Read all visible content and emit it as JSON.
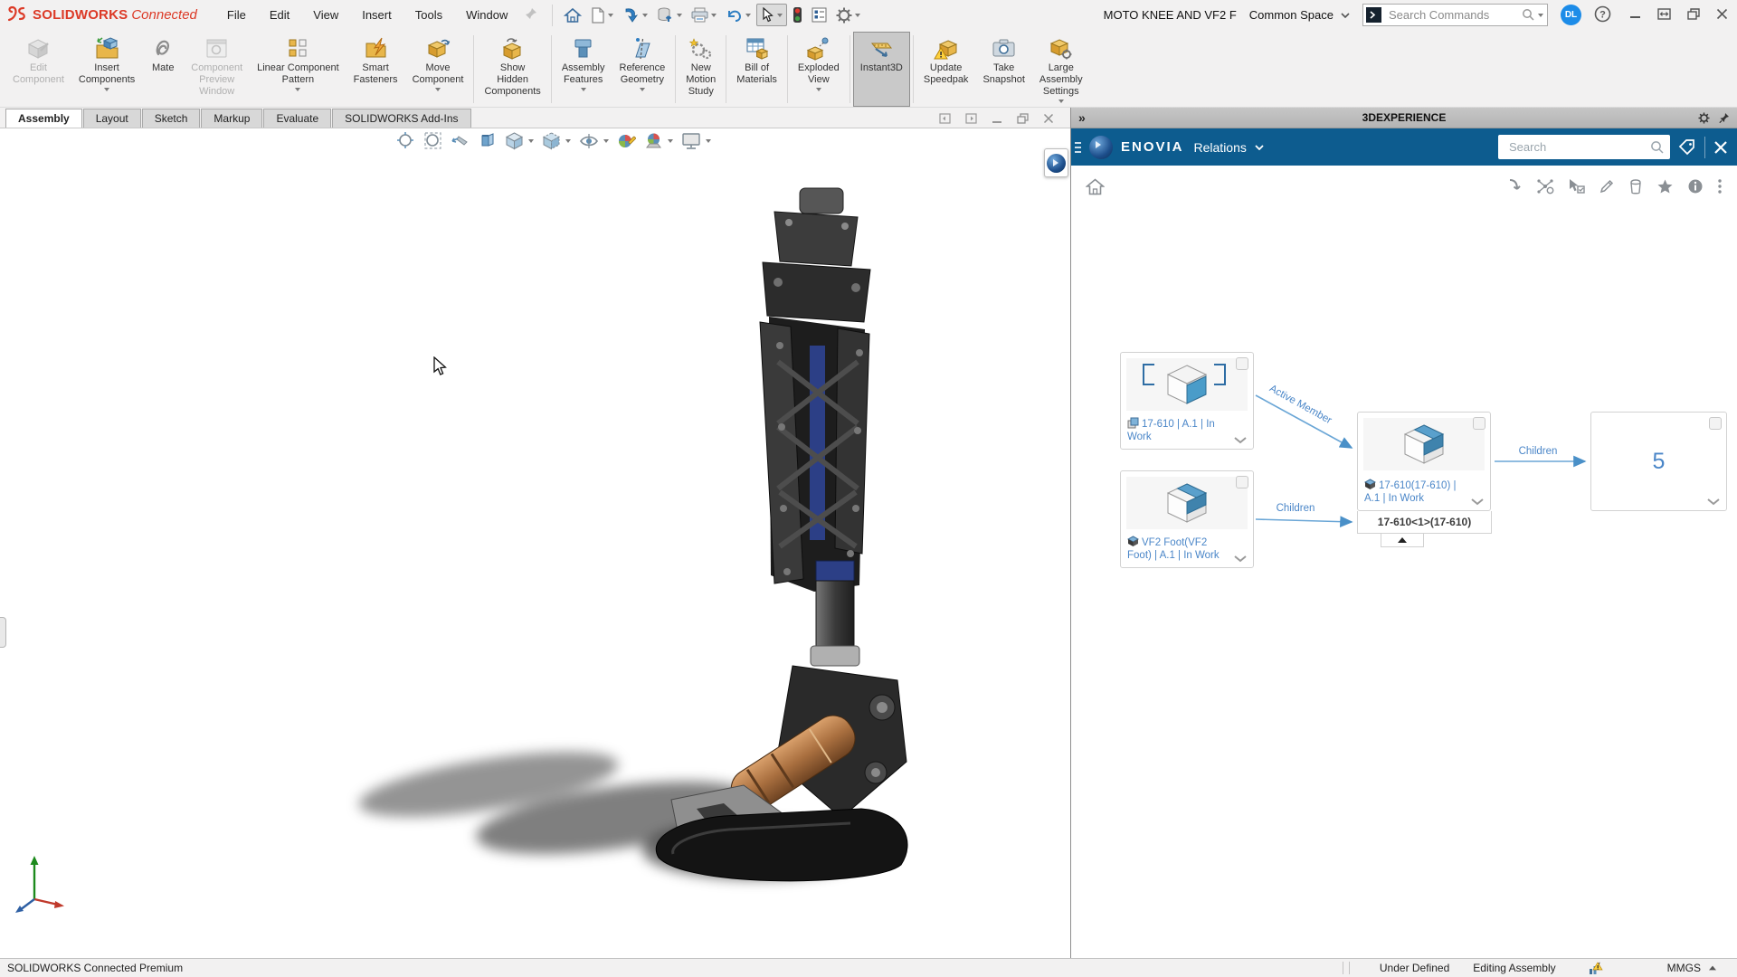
{
  "app": {
    "brand": "SOLIDWORKS",
    "brand_suffix": "Connected"
  },
  "menubar": {
    "menus": [
      "File",
      "Edit",
      "View",
      "Insert",
      "Tools",
      "Window"
    ],
    "doc_title": "MOTO KNEE AND VF2 F",
    "space": "Common Space",
    "search_placeholder": "Search Commands",
    "avatar_initials": "DL"
  },
  "ribbon": {
    "buttons": [
      {
        "label": "Edit\nComponent"
      },
      {
        "label": "Insert\nComponents"
      },
      {
        "label": "Mate"
      },
      {
        "label": "Component\nPreview\nWindow"
      },
      {
        "label": "Linear Component\nPattern"
      },
      {
        "label": "Smart\nFasteners"
      },
      {
        "label": "Move\nComponent"
      },
      {
        "label": "Show\nHidden\nComponents"
      },
      {
        "label": "Assembly\nFeatures"
      },
      {
        "label": "Reference\nGeometry"
      },
      {
        "label": "New\nMotion\nStudy"
      },
      {
        "label": "Bill of\nMaterials"
      },
      {
        "label": "Exploded\nView"
      },
      {
        "label": "Instant3D"
      },
      {
        "label": "Update\nSpeedpak"
      },
      {
        "label": "Take\nSnapshot"
      },
      {
        "label": "Large\nAssembly\nSettings"
      }
    ]
  },
  "tabbar": {
    "tabs": [
      "Assembly",
      "Layout",
      "Sketch",
      "Markup",
      "Evaluate",
      "SOLIDWORKS Add-Ins"
    ]
  },
  "panel": {
    "window_title": "3DEXPERIENCE",
    "app_name": "ENOVIA",
    "view_name": "Relations",
    "search_placeholder": "Search",
    "graph": {
      "nodes": [
        {
          "label": "17-610 | A.1 | In Work"
        },
        {
          "label": "VF2 Foot(VF2 Foot) | A.1 | In Work"
        },
        {
          "label": "17-610(17-610) | A.1 | In Work",
          "sublabel": "17-610<1>(17-610)"
        },
        {
          "count": "5"
        }
      ],
      "edges": [
        {
          "label": "Active Member"
        },
        {
          "label": "Children"
        },
        {
          "label": "Children"
        }
      ]
    }
  },
  "statusbar": {
    "left": "SOLIDWORKS Connected Premium",
    "constraint_status": "Under Defined",
    "mode": "Editing Assembly",
    "units": "MMGS"
  }
}
